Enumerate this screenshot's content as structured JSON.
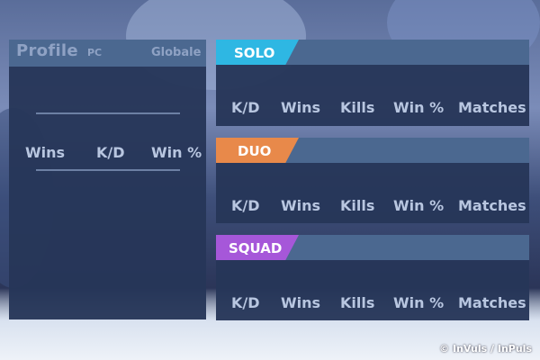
{
  "profile": {
    "title": "Profile",
    "platform": "PC",
    "scope": "Globale",
    "stats": [
      "Wins",
      "K/D",
      "Win %"
    ]
  },
  "modes": [
    {
      "name": "SOLO",
      "color": "#2eb7e3",
      "stats": [
        "K/D",
        "Wins",
        "Kills",
        "Win %",
        "Matches"
      ]
    },
    {
      "name": "DUO",
      "color": "#e8894a",
      "stats": [
        "K/D",
        "Wins",
        "Kills",
        "Win %",
        "Matches"
      ]
    },
    {
      "name": "SQUAD",
      "color": "#a657d9",
      "stats": [
        "K/D",
        "Wins",
        "Kills",
        "Win %",
        "Matches"
      ]
    }
  ],
  "credit": "© InVuls / InPuls"
}
